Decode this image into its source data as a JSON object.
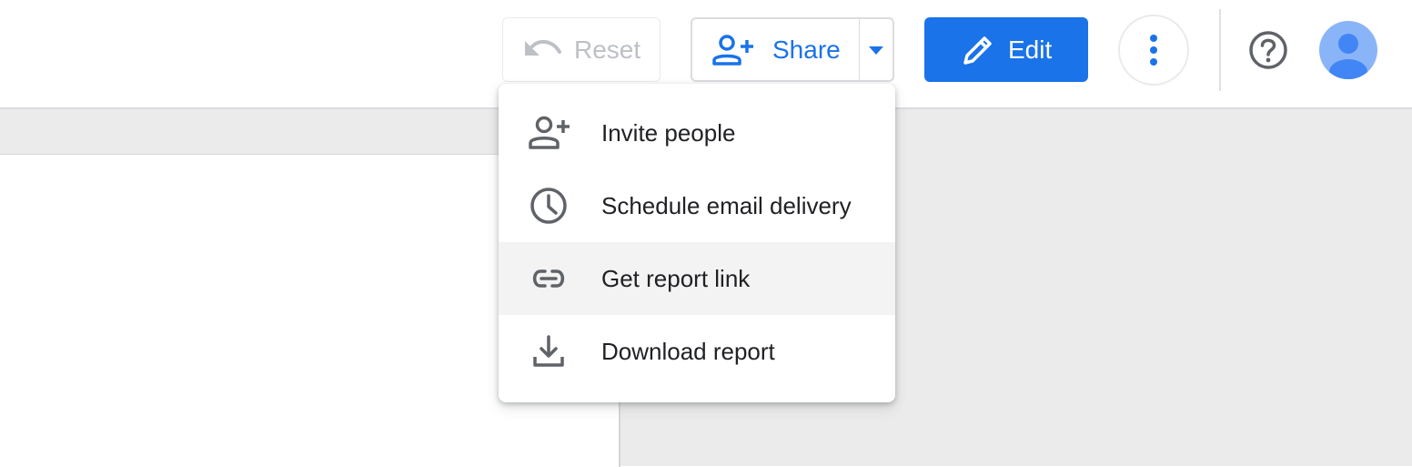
{
  "toolbar": {
    "reset_label": "Reset",
    "share_label": "Share",
    "edit_label": "Edit"
  },
  "share_menu": {
    "items": [
      {
        "label": "Invite people",
        "icon": "person-add-icon"
      },
      {
        "label": "Schedule email delivery",
        "icon": "clock-icon"
      },
      {
        "label": "Get report link",
        "icon": "link-icon"
      },
      {
        "label": "Download report",
        "icon": "download-icon"
      }
    ],
    "highlighted_item": "Get report link"
  },
  "colors": {
    "accent": "#1a73e8",
    "disabled_text": "#bdc1c6",
    "menu_icon": "#5f6368",
    "canvas_background": "#ebebeb",
    "avatar_background": "#8ab4f8",
    "avatar_figure": "#4285f4"
  },
  "icons": {
    "reset": "undo-icon",
    "share": "person-add-icon",
    "share_dropdown": "caret-down-icon",
    "edit": "pencil-icon",
    "more": "more-vert-icon",
    "help": "help-circle-icon",
    "account": "account-avatar"
  }
}
